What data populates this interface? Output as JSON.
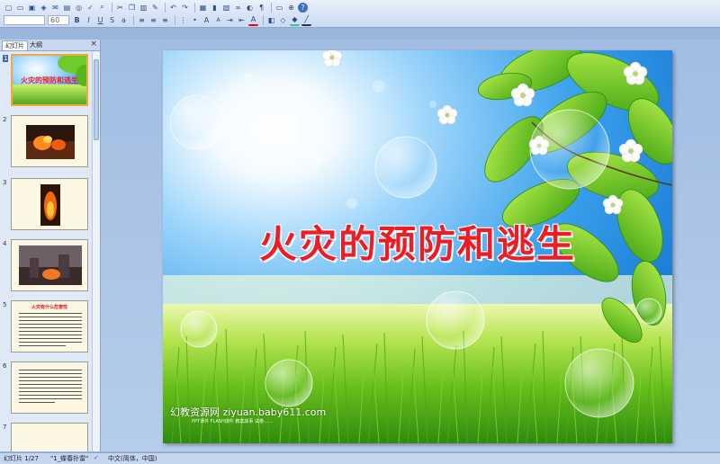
{
  "toolbar": {
    "font_name": "",
    "font_size": "60",
    "row1_icons": [
      "new-icon",
      "open-icon",
      "save-icon",
      "permission-icon",
      "email-icon",
      "print-icon",
      "print-preview-icon",
      "spelling-icon",
      "research-icon",
      "cut-icon",
      "copy-icon",
      "paste-icon",
      "format-painter-icon",
      "undo-icon",
      "redo-icon",
      "insert-table-icon",
      "insert-chart-icon",
      "insert-picture-icon",
      "hyperlink-icon",
      "grayscale-icon",
      "show-formatting-icon",
      "new-slide-icon",
      "zoom-icon",
      "help-icon"
    ],
    "row2_icons": [
      "bold-icon",
      "italic-icon",
      "underline-icon",
      "shadow-icon",
      "strikethrough-icon",
      "align-left-icon",
      "align-center-icon",
      "align-right-icon",
      "numbering-icon",
      "bullets-icon",
      "increase-font-icon",
      "decrease-font-icon",
      "indent-icon",
      "outdent-icon",
      "font-color-icon",
      "design-icon",
      "shapes-icon",
      "fill-color-icon",
      "line-color-icon"
    ]
  },
  "pane": {
    "tab_slides": "幻灯片",
    "tab_outline": "大纲",
    "close": "×",
    "slides": [
      {
        "num": "1",
        "selected": true,
        "caption": "火灾的预防和逃生"
      },
      {
        "num": "2",
        "selected": false,
        "caption": ""
      },
      {
        "num": "3",
        "selected": false,
        "caption": ""
      },
      {
        "num": "4",
        "selected": false,
        "caption": ""
      },
      {
        "num": "5",
        "selected": false,
        "caption": "火灾有什么危害性"
      },
      {
        "num": "6",
        "selected": false,
        "caption": ""
      },
      {
        "num": "7",
        "selected": false,
        "caption": ""
      }
    ]
  },
  "slide": {
    "title": "火灾的预防和逃生",
    "watermark": "幻教资源网 ziyuan.baby611.com",
    "watermark_sub": "PPT课件  FLASH课件  教案故事  试卷……"
  },
  "status": {
    "slide_info": "幻灯片 1/27",
    "theme": "\"1_蝶春扑雷\"",
    "language": "中文(简体，中国)"
  }
}
